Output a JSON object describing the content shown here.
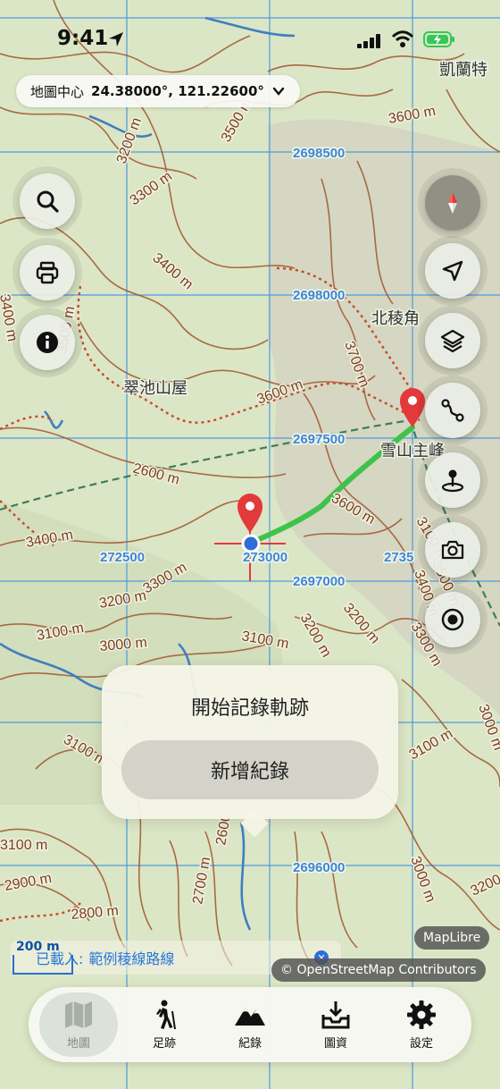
{
  "status_bar": {
    "time": "9:41"
  },
  "center_pill": {
    "label": "地圖中心",
    "coords": "24.38000°, 121.22600°"
  },
  "map": {
    "place_labels": [
      "凱蘭特",
      "北稜角",
      "翠池山屋",
      "雪山主峰"
    ],
    "grid_labels": [
      "2698500",
      "2698000",
      "2697500",
      "2697000",
      "2696000",
      "272500",
      "273000",
      "2735"
    ],
    "contour_labels": [
      "3600 m",
      "3500 m",
      "3200 m",
      "3300 m",
      "3400 m",
      "3500 m",
      "3600 m",
      "2600 m",
      "3400 m",
      "3300 m",
      "3200 m",
      "3200 m",
      "3100 m",
      "3000 m",
      "3100 m",
      "3200 m",
      "3300 m",
      "3400 m",
      "3700 m",
      "3600 m",
      "3100 m",
      "3500 m",
      "2600",
      "2700 m",
      "2900 m",
      "2800 m",
      "3000 m",
      "3100 m",
      "3200 m",
      "3000 m",
      "3100 m",
      "3100 m",
      "3400 m"
    ]
  },
  "controls": {
    "left": [
      {
        "icon": "search-icon"
      },
      {
        "icon": "print-icon"
      },
      {
        "icon": "info-icon"
      }
    ],
    "right": [
      {
        "icon": "compass-icon"
      },
      {
        "icon": "locate-arrow-icon"
      },
      {
        "icon": "layers-icon"
      },
      {
        "icon": "route-icon"
      },
      {
        "icon": "waypoint-pin-icon"
      },
      {
        "icon": "camera-icon"
      },
      {
        "icon": "record-icon"
      }
    ]
  },
  "popup": {
    "title": "開始記錄軌跡",
    "button": "新增紀錄"
  },
  "loaded": {
    "prefix": "已載入:",
    "name": "範例稜線路線"
  },
  "scale": {
    "label": "200 m"
  },
  "attribution": {
    "maplibre": "MapLibre",
    "osm": "© OpenStreetMap Contributors"
  },
  "tabs": [
    {
      "label": "地圖",
      "icon": "map-icon",
      "active": true
    },
    {
      "label": "足跡",
      "icon": "hiker-icon",
      "active": false
    },
    {
      "label": "紀錄",
      "icon": "mountains-icon",
      "active": false
    },
    {
      "label": "圖資",
      "icon": "download-tray-icon",
      "active": false
    },
    {
      "label": "設定",
      "icon": "gear-icon",
      "active": false
    }
  ],
  "colors": {
    "track": "#3fc24a",
    "grid": "#4c9be0",
    "contour": "#a0552c",
    "pin": "#e4393a"
  }
}
